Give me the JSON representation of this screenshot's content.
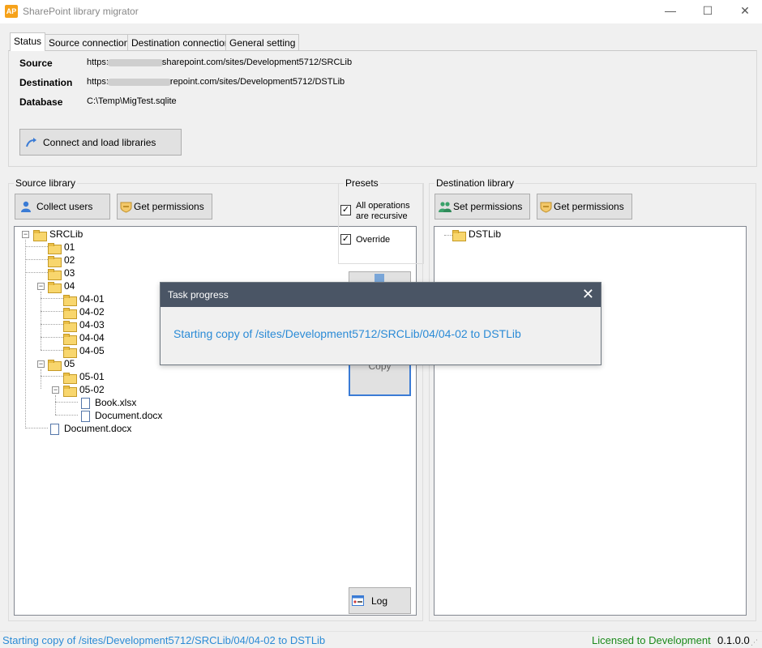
{
  "window": {
    "app_icon": "AP",
    "title": "SharePoint library migrator",
    "minimize": "—",
    "maximize": "☐",
    "close": "✕"
  },
  "tabs": [
    {
      "label": "Status",
      "active": true
    },
    {
      "label": "Source connection",
      "active": false
    },
    {
      "label": "Destination connection",
      "active": false
    },
    {
      "label": "General setting",
      "active": false
    }
  ],
  "status_panel": {
    "source_label": "Source",
    "source_value_prefix": "https:",
    "source_value_suffix": "sharepoint.com/sites/Development5712/SRCLib",
    "destination_label": "Destination",
    "destination_value_prefix": "https:",
    "destination_value_suffix": "repoint.com/sites/Development5712/DSTLib",
    "database_label": "Database",
    "database_value": "C:\\Temp\\MigTest.sqlite",
    "connect_button": "Connect and load libraries"
  },
  "source_library": {
    "title": "Source library",
    "collect_users_button": "Collect users",
    "get_permissions_button": "Get permissions",
    "tree": [
      {
        "label": "SRCLib",
        "type": "folder"
      },
      {
        "label": "01",
        "type": "folder"
      },
      {
        "label": "02",
        "type": "folder"
      },
      {
        "label": "03",
        "type": "folder"
      },
      {
        "label": "04",
        "type": "folder"
      },
      {
        "label": "04-01",
        "type": "folder"
      },
      {
        "label": "04-02",
        "type": "folder"
      },
      {
        "label": "04-03",
        "type": "folder"
      },
      {
        "label": "04-04",
        "type": "folder"
      },
      {
        "label": "04-05",
        "type": "folder"
      },
      {
        "label": "05",
        "type": "folder"
      },
      {
        "label": "05-01",
        "type": "folder"
      },
      {
        "label": "05-02",
        "type": "folder"
      },
      {
        "label": "Book.xlsx",
        "type": "file"
      },
      {
        "label": "Document.docx",
        "type": "file"
      },
      {
        "label": "Document.docx",
        "type": "file"
      }
    ]
  },
  "presets": {
    "title": "Presets",
    "recursive_label_line1": "All operations",
    "recursive_label_line2": "are recursive",
    "recursive_checked": true,
    "override_label": "Override",
    "override_checked": true,
    "check_mark": "✓"
  },
  "copy_button": "Copy",
  "log_button": "Log",
  "destination_library": {
    "title": "Destination library",
    "set_permissions_button": "Set permissions",
    "get_permissions_button": "Get permissions",
    "tree": [
      {
        "label": "DSTLib",
        "type": "folder"
      }
    ]
  },
  "task_dialog": {
    "title": "Task progress",
    "close": "✕",
    "message": "Starting copy of /sites/Development5712/SRCLib/04/04-02 to DSTLib"
  },
  "status_bar": {
    "message": "Starting copy of /sites/Development5712/SRCLib/04/04-02 to DSTLib",
    "license": "Licensed to Development",
    "version": "0.1.0.0"
  },
  "colors": {
    "accent_blue": "#2b8bd6",
    "license_green": "#1a8a1a",
    "dialog_header": "#4a5565"
  }
}
